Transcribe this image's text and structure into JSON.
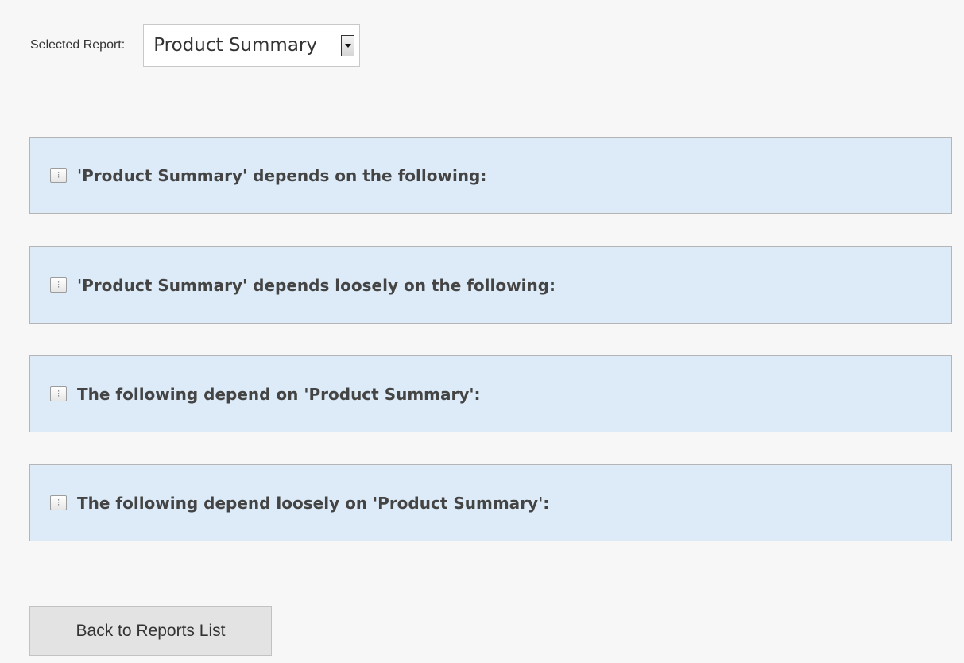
{
  "report_selector": {
    "label": "Selected Report:",
    "selected_value": "Product Summary"
  },
  "panels": [
    {
      "title": "'Product Summary' depends on the following:",
      "toggle_icon": "expand-icon",
      "expanded": false
    },
    {
      "title": "'Product Summary' depends loosely on the following:",
      "toggle_icon": "expand-icon",
      "expanded": false
    },
    {
      "title": "The following depend on 'Product Summary':",
      "toggle_icon": "expand-icon",
      "expanded": false
    },
    {
      "title": "The following depend loosely on 'Product Summary':",
      "toggle_icon": "expand-icon",
      "expanded": false
    }
  ],
  "footer": {
    "back_label": "Back to Reports List"
  },
  "colors": {
    "panel_background": "#dcebf7",
    "page_background": "#f7f7f7",
    "button_background": "#e3e3e3"
  }
}
